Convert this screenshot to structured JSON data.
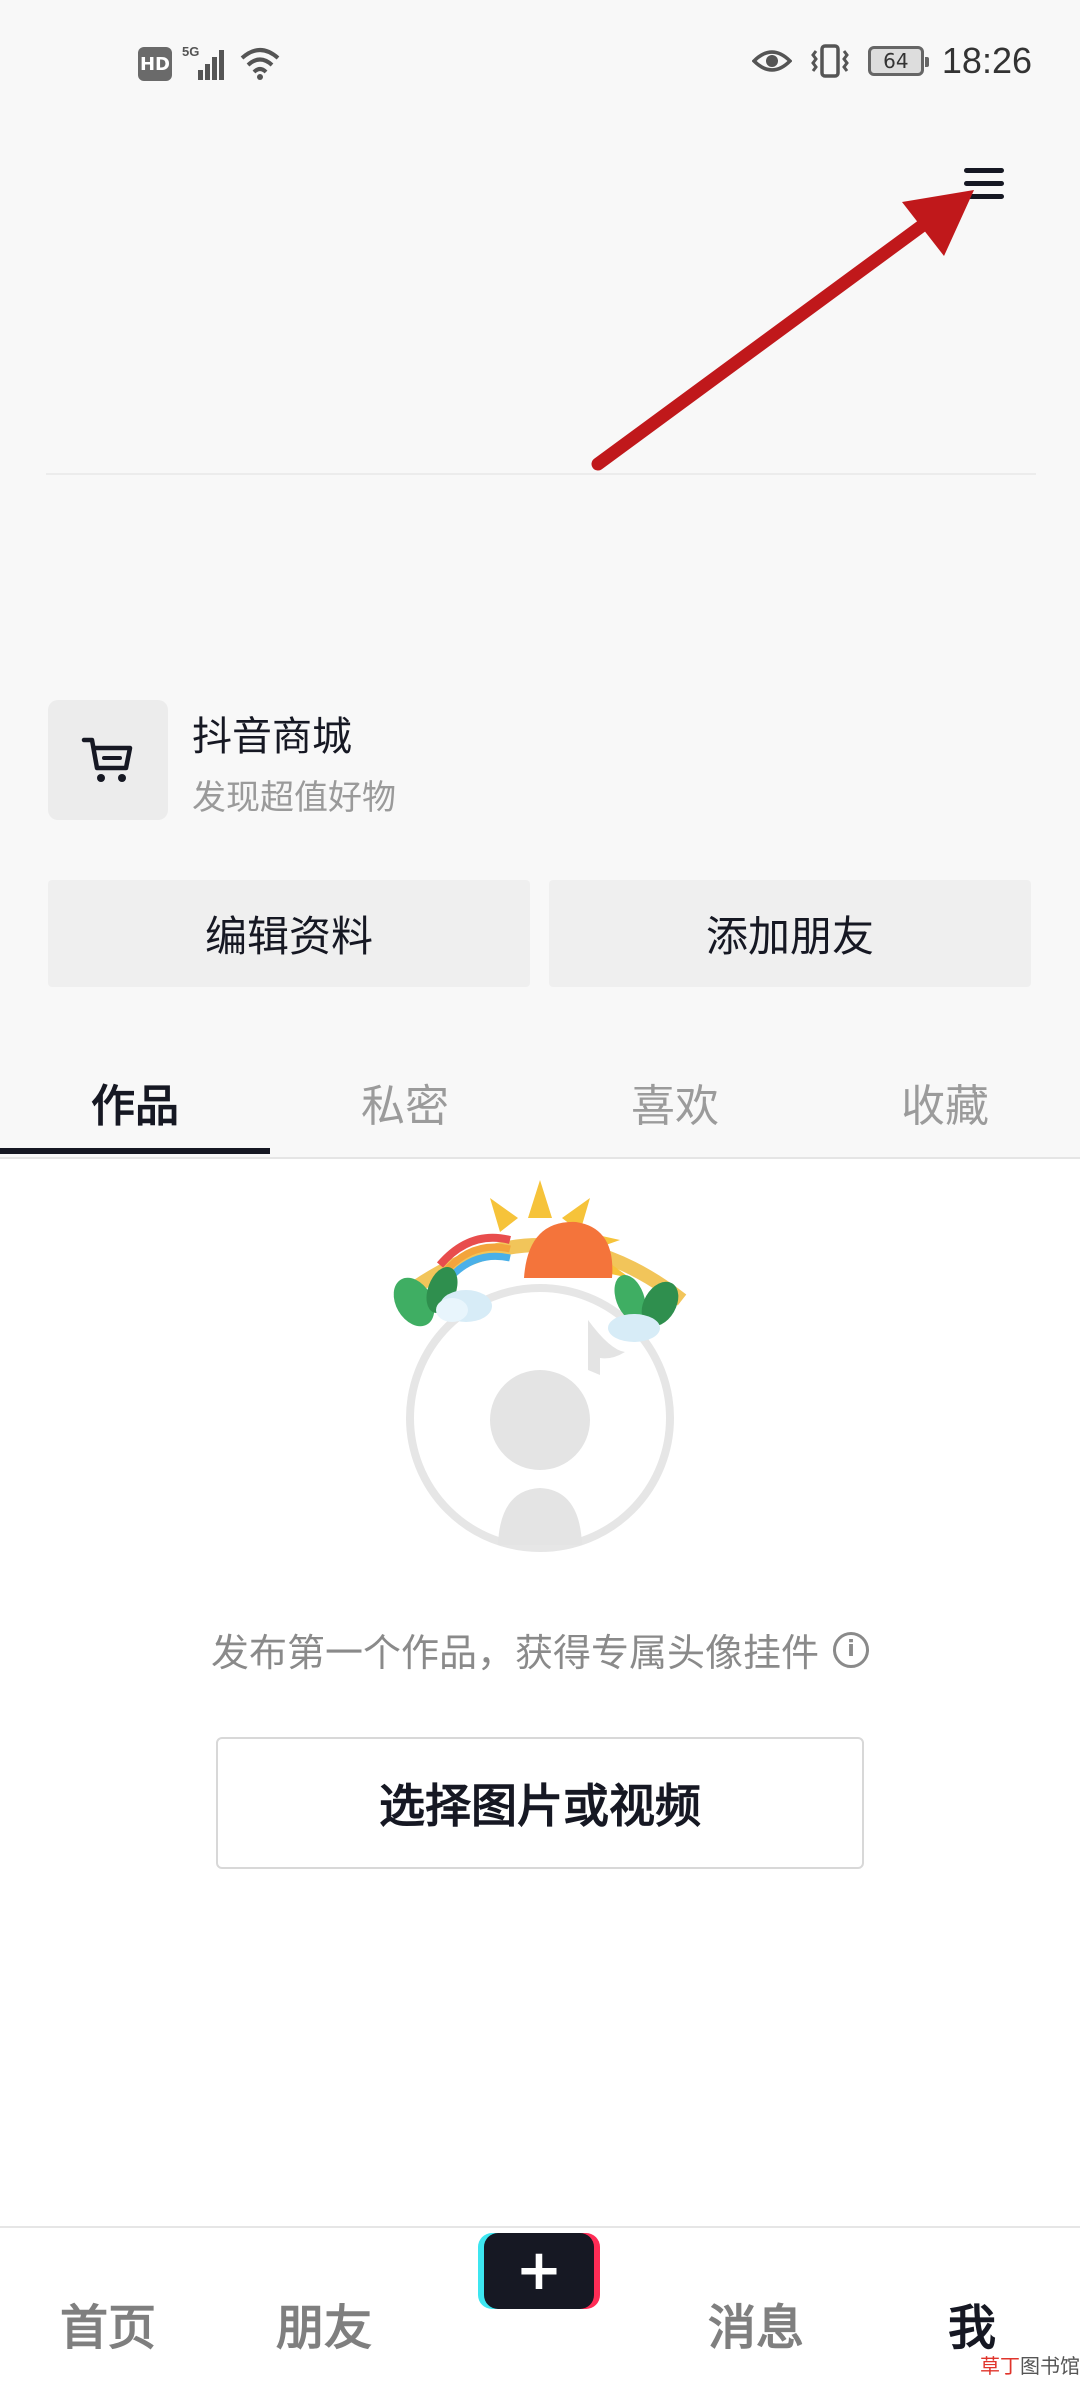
{
  "status_bar": {
    "hd": "HD",
    "network": "5G",
    "battery": "64",
    "time": "18:26"
  },
  "shop": {
    "title": "抖音商城",
    "subtitle": "发现超值好物"
  },
  "profile_buttons": {
    "edit": "编辑资料",
    "add_friend": "添加朋友"
  },
  "tabs": [
    {
      "label": "作品",
      "active": true
    },
    {
      "label": "私密",
      "active": false
    },
    {
      "label": "喜欢",
      "active": false
    },
    {
      "label": "收藏",
      "active": false
    }
  ],
  "empty_state": {
    "hint": "发布第一个作品，获得专属头像挂件",
    "button": "选择图片或视频"
  },
  "bottom_nav": {
    "home": "首页",
    "friends": "朋友",
    "plus": "+",
    "messages": "消息",
    "me": "我"
  },
  "watermark": {
    "part1": "草丁",
    "part2": "图书馆"
  },
  "colors": {
    "primary_text": "#161823",
    "accent_red": "#fe2c55",
    "accent_cyan": "#3de6f0",
    "annotation_arrow": "#c0181b"
  }
}
